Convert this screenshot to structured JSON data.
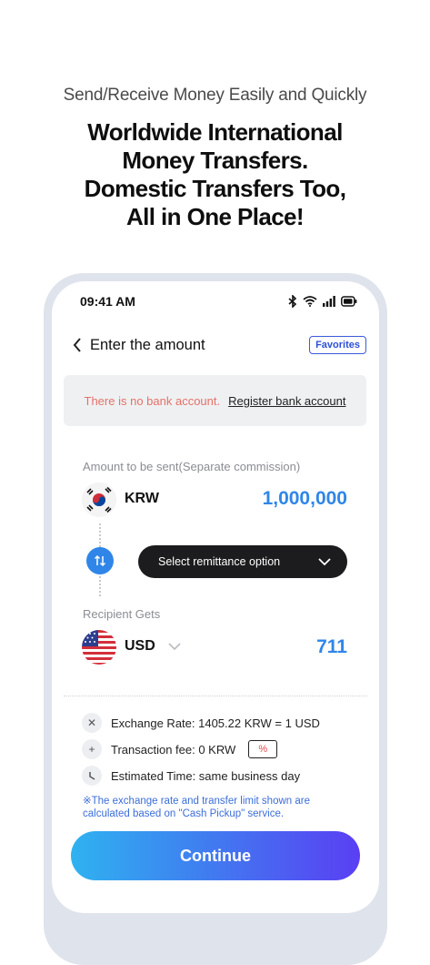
{
  "promo": {
    "tagline": "Send/Receive Money Easily and Quickly",
    "headline_lines": [
      "Worldwide International",
      "Money Transfers.",
      "Domestic Transfers Too,",
      "All in One Place!"
    ]
  },
  "status_bar": {
    "time": "09:41 AM"
  },
  "nav": {
    "title": "Enter the amount",
    "favorites_label": "Favorites"
  },
  "notice": {
    "warning": "There is no bank account.",
    "register_link": "Register bank account"
  },
  "send": {
    "label": "Amount to be sent(Separate commission)",
    "currency": "KRW",
    "amount": "1,000,000"
  },
  "remittance": {
    "select_label": "Select remittance option"
  },
  "receive": {
    "label": "Recipient Gets",
    "currency": "USD",
    "amount": "711"
  },
  "details": {
    "exchange_rate": "Exchange Rate: 1405.22 KRW = 1 USD",
    "transaction_fee": "Transaction fee: 0 KRW",
    "fee_badge": "%",
    "estimated_time": "Estimated Time: same business day",
    "note": "※The exchange rate and transfer limit shown are calculated based on \"Cash Pickup\" service."
  },
  "continue_label": "Continue",
  "colors": {
    "accent": "#2f86e8",
    "warning": "#e57168",
    "link_blue": "#3b6ed9"
  }
}
